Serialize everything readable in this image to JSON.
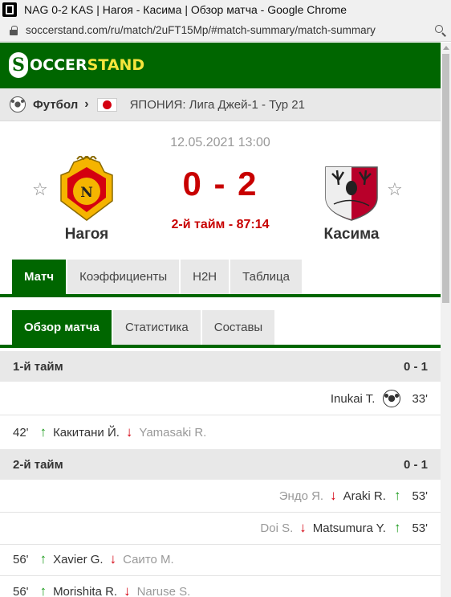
{
  "window": {
    "title": "NAG 0-2 KAS | Нагоя - Касима | Обзор матча - Google Chrome",
    "url": "soccerstand.com/ru/match/2uFT15Mp/#match-summary/match-summary"
  },
  "brand": {
    "prefix": "OCCER",
    "accent": "STAND",
    "badge": "S"
  },
  "breadcrumb": {
    "sport": "Футбол",
    "sep": "›",
    "league": "ЯПОНИЯ: Лига Джей-1 - Тур 21"
  },
  "match": {
    "date": "12.05.2021 13:00",
    "home": "Нагоя",
    "away": "Касима",
    "score": "0 - 2",
    "status": "2-й тайм - 87:14",
    "star": "☆"
  },
  "tabs_main": [
    "Матч",
    "Коэффициенты",
    "H2H",
    "Таблица"
  ],
  "tabs_sub": [
    "Обзор матча",
    "Статистика",
    "Составы"
  ],
  "summary": {
    "period1": {
      "label": "1-й тайм",
      "score": "0 - 1"
    },
    "goal1": {
      "player": "Inukai T.",
      "minute": "33'"
    },
    "sub1": {
      "minute": "42'",
      "in": "Какитани Й.",
      "out": "Yamasaki R."
    },
    "period2": {
      "label": "2-й тайм",
      "score": "0 - 1"
    },
    "sub2": {
      "out": "Эндо Я.",
      "in": "Araki R.",
      "minute": "53'"
    },
    "sub3": {
      "out": "Doi S.",
      "in": "Matsumura Y.",
      "minute": "53'"
    },
    "sub4": {
      "minute": "56'",
      "in": "Xavier G.",
      "out": "Саито М."
    },
    "sub5": {
      "minute": "56'",
      "in": "Morishita R.",
      "out": "Naruse S."
    }
  },
  "arrows": {
    "up": "↑",
    "down": "↓"
  },
  "colors": {
    "brand_green": "#006600",
    "score_red": "#c80000",
    "sub_in": "#1a9a1a",
    "sub_out": "#d40010"
  }
}
